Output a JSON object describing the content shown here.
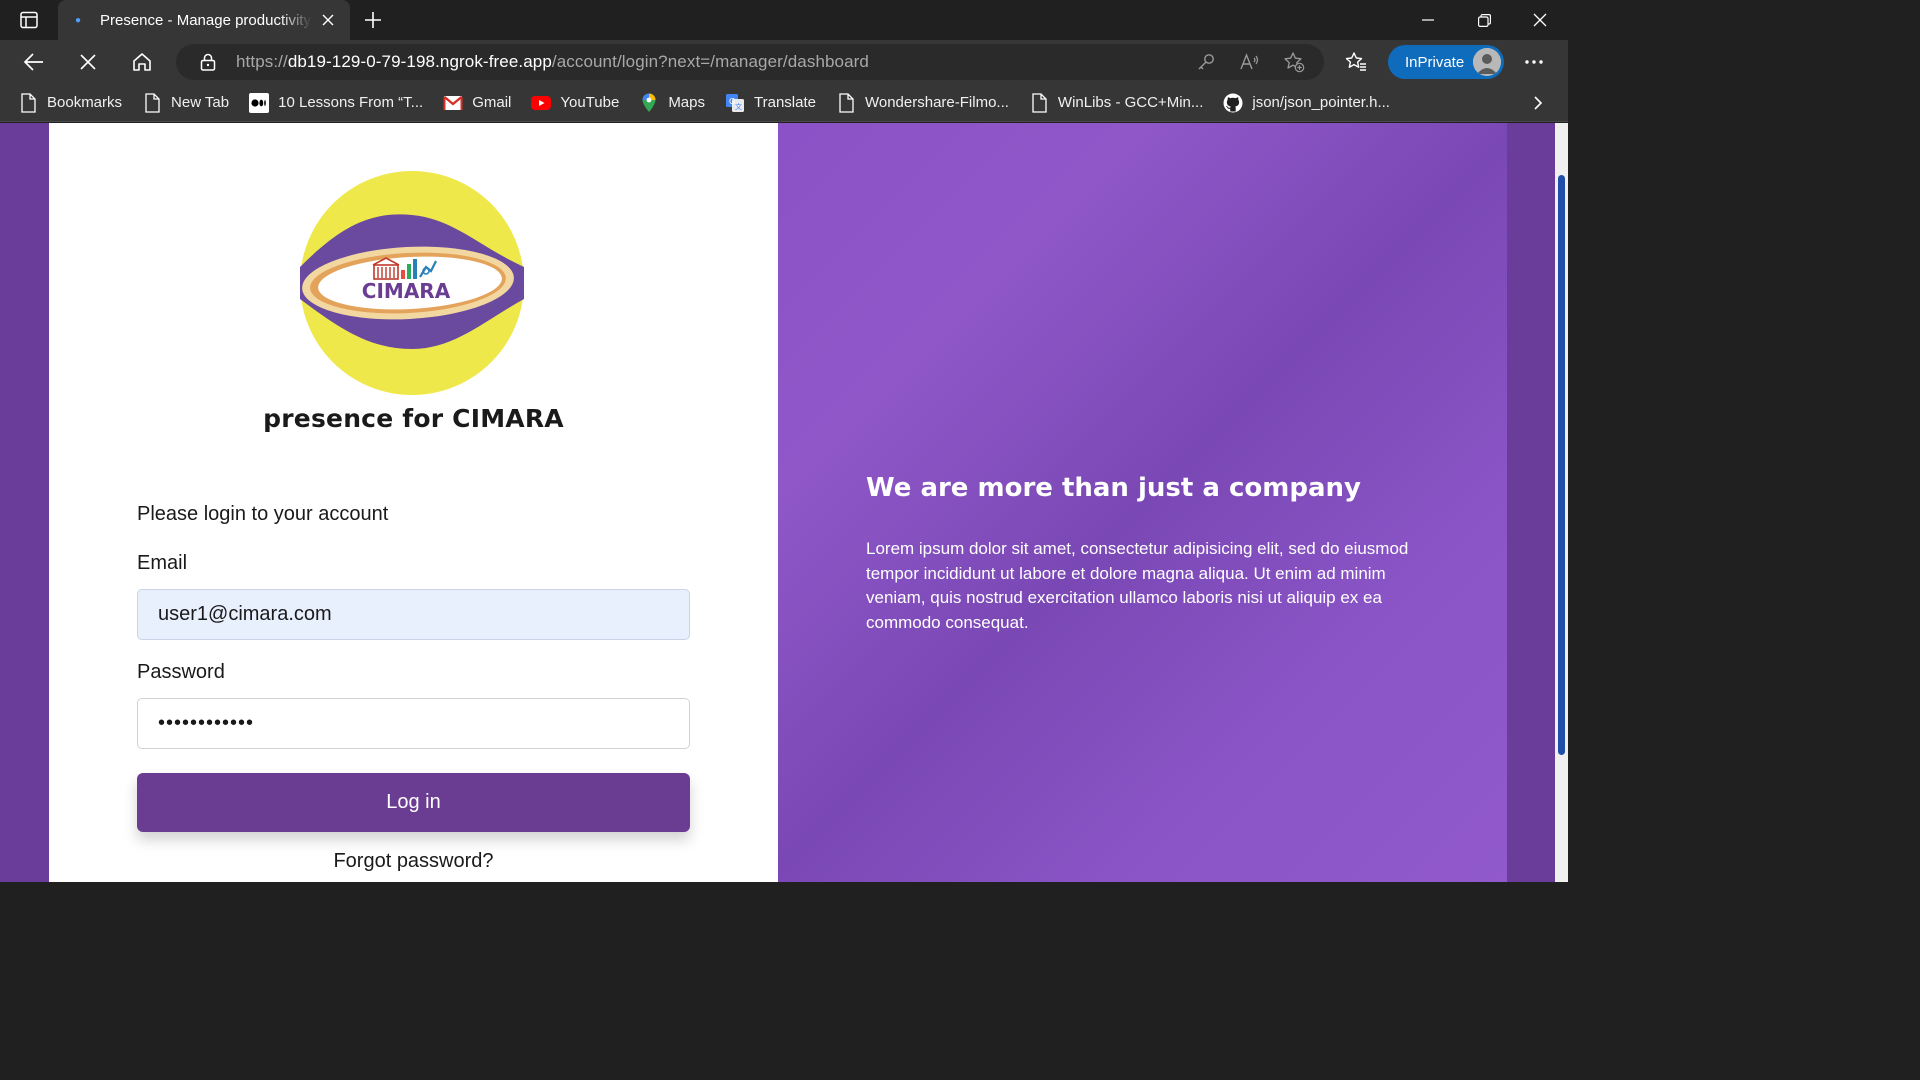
{
  "browser": {
    "tab": {
      "title": "Presence - Manage productivity with CIMARA"
    },
    "address": {
      "scheme": "https://",
      "host": "db19-129-0-79-198.ngrok-free.app",
      "path": "/account/login?next=/manager/dashboard"
    },
    "profile_label": "InPrivate",
    "bookmarks": [
      {
        "label": "Bookmarks",
        "icon": "page-icon"
      },
      {
        "label": "New Tab",
        "icon": "page-icon"
      },
      {
        "label": "10 Lessons From “T...",
        "icon": "medium-icon"
      },
      {
        "label": "Gmail",
        "icon": "gmail-icon"
      },
      {
        "label": "YouTube",
        "icon": "youtube-icon"
      },
      {
        "label": "Maps",
        "icon": "maps-pin-icon"
      },
      {
        "label": "Translate",
        "icon": "translate-icon"
      },
      {
        "label": "Wondershare-Filmo...",
        "icon": "page-icon"
      },
      {
        "label": "WinLibs - GCC+Min...",
        "icon": "page-icon"
      },
      {
        "label": "json/json_pointer.h...",
        "icon": "github-icon"
      }
    ]
  },
  "login": {
    "logo_text": "CIMARA",
    "brand_title": "presence for CIMARA",
    "prompt": "Please login to your account",
    "email_label": "Email",
    "email_value": "user1@cimara.com",
    "password_label": "Password",
    "password_value": "••••••••••••",
    "submit_label": "Log in",
    "forgot_label": "Forgot password?"
  },
  "promo": {
    "heading": "We are more than just a company",
    "body": "Lorem ipsum dolor sit amet, consectetur adipisicing elit, sed do eiusmod tempor incididunt ut labore et dolore magna aliqua. Ut enim ad minim veniam, quis nostrud exercitation ullamco laboris nisi ut aliquip ex ea commodo consequat."
  },
  "colors": {
    "page_background": "#6a3d9a",
    "promo_background": "#8b55c7",
    "login_button": "#6a3d92",
    "logo_yellow": "#efe84a",
    "logo_purple": "#6a4a9e",
    "inprivate_badge": "#0f6cbd"
  }
}
